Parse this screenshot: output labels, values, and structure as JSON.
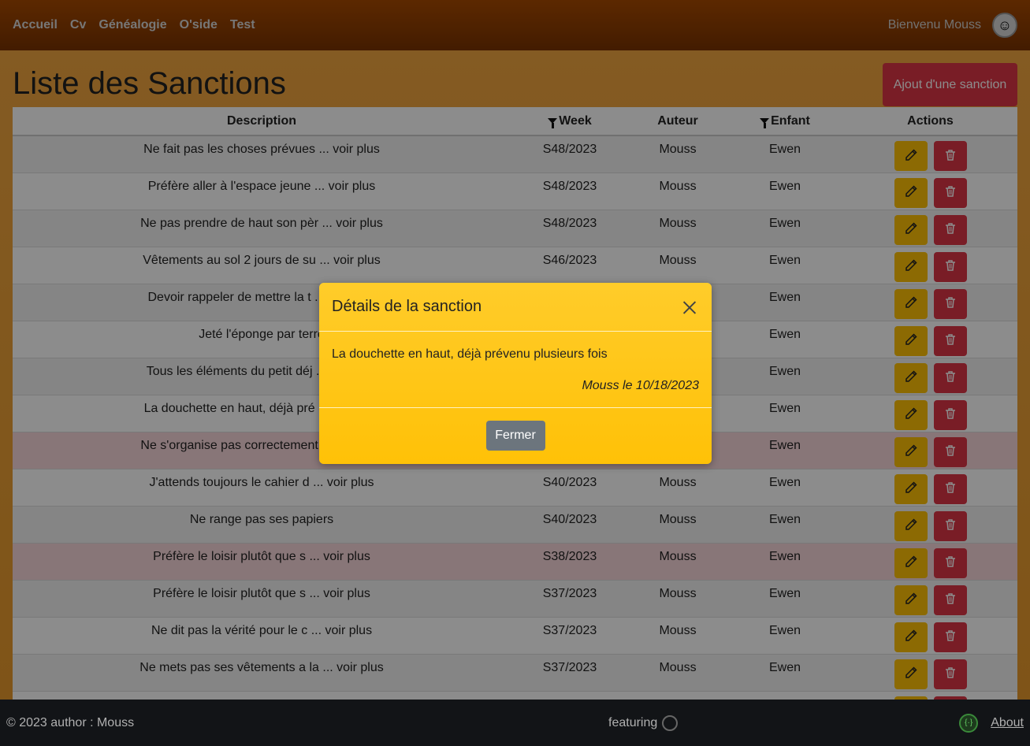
{
  "nav": {
    "links": [
      "Accueil",
      "Cv",
      "Généalogie",
      "O'side",
      "Test"
    ],
    "welcome": "Bienvenu Mouss"
  },
  "page": {
    "title": "Liste des Sanctions",
    "add_button": "Ajout d'une sanction"
  },
  "table": {
    "headers": {
      "description": "Description",
      "week": "Week",
      "auteur": "Auteur",
      "enfant": "Enfant",
      "actions": "Actions"
    },
    "rows": [
      {
        "description": "Ne fait pas les choses prévues ... voir plus",
        "week": "S48/2023",
        "auteur": "Mouss",
        "enfant": "Ewen",
        "style": "odd"
      },
      {
        "description": "Préfère aller à l'espace jeune ... voir plus",
        "week": "S48/2023",
        "auteur": "Mouss",
        "enfant": "Ewen",
        "style": "even"
      },
      {
        "description": "Ne pas prendre de haut son pèr ... voir plus",
        "week": "S48/2023",
        "auteur": "Mouss",
        "enfant": "Ewen",
        "style": "odd"
      },
      {
        "description": "Vêtements au sol 2 jours de su ... voir plus",
        "week": "S46/2023",
        "auteur": "Mouss",
        "enfant": "Ewen",
        "style": "even"
      },
      {
        "description": "Devoir rappeler de mettre la t ... voir plus",
        "week": "",
        "auteur": "",
        "enfant": "Ewen",
        "style": "odd"
      },
      {
        "description": "Jeté l'éponge par terre",
        "week": "",
        "auteur": "",
        "enfant": "Ewen",
        "style": "even"
      },
      {
        "description": "Tous les éléments du petit déj ... voir plus",
        "week": "",
        "auteur": "",
        "enfant": "Ewen",
        "style": "odd"
      },
      {
        "description": "La douchette en haut, déjà pré ... voir plus",
        "week": "",
        "auteur": "",
        "enfant": "Ewen",
        "style": "even"
      },
      {
        "description": "Ne s'organise pas correctement ... voir plus",
        "week": "",
        "auteur": "",
        "enfant": "Ewen",
        "style": "danger"
      },
      {
        "description": "J'attends toujours le cahier d ... voir plus",
        "week": "S40/2023",
        "auteur": "Mouss",
        "enfant": "Ewen",
        "style": "even"
      },
      {
        "description": "Ne range pas ses papiers",
        "week": "S40/2023",
        "auteur": "Mouss",
        "enfant": "Ewen",
        "style": "odd"
      },
      {
        "description": "Préfère le loisir plutôt que s ... voir plus",
        "week": "S38/2023",
        "auteur": "Mouss",
        "enfant": "Ewen",
        "style": "danger"
      },
      {
        "description": "Préfère le loisir plutôt que s ... voir plus",
        "week": "S37/2023",
        "auteur": "Mouss",
        "enfant": "Ewen",
        "style": "odd"
      },
      {
        "description": "Ne dit pas la vérité pour le c ... voir plus",
        "week": "S37/2023",
        "auteur": "Mouss",
        "enfant": "Ewen",
        "style": "even"
      },
      {
        "description": "Ne mets pas ses vêtements a la ... voir plus",
        "week": "S37/2023",
        "auteur": "Mouss",
        "enfant": "Ewen",
        "style": "odd"
      },
      {
        "description": "",
        "week": "",
        "auteur": "",
        "enfant": "",
        "style": "even"
      }
    ]
  },
  "modal": {
    "title": "Détails de la sanction",
    "text": "La douchette en haut, déjà prévenu plusieurs fois",
    "meta": "Mouss le 10/18/2023",
    "close_button": "Fermer"
  },
  "footer": {
    "copyright": "© 2023 author : Mouss",
    "featuring": "featuring",
    "about": "About"
  },
  "icons": {
    "edit": "pencil-icon",
    "delete": "trash-icon",
    "filter": "filter-icon",
    "close": "close-icon"
  },
  "colors": {
    "navbar": "#7a3300",
    "danger": "#dc3545",
    "warning": "#ffc107",
    "secondary": "#6c757d"
  }
}
